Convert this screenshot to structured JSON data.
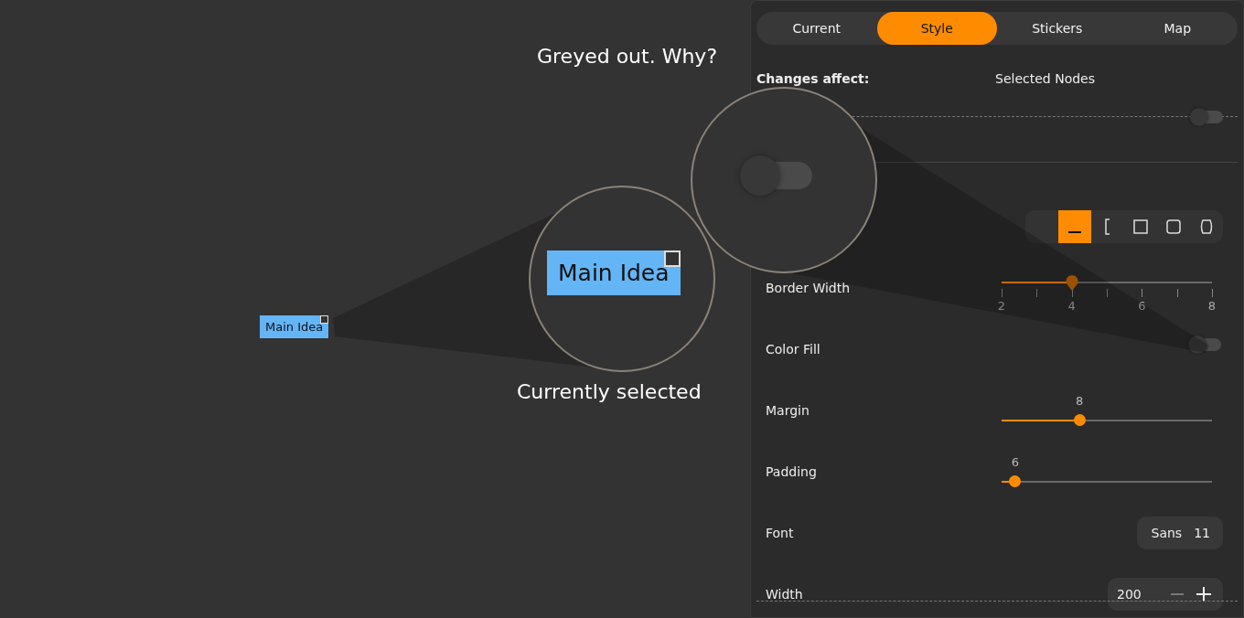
{
  "canvas": {
    "node": {
      "label": "Main Idea",
      "selected": true
    }
  },
  "annotations": [
    {
      "kind": "toggle",
      "on": false,
      "caption": "Greyed out. Why?"
    },
    {
      "kind": "node",
      "label": "Main Idea",
      "selected": true,
      "caption": "Currently selected"
    }
  ],
  "panel": {
    "tabs": [
      {
        "label": "Current",
        "selected": false
      },
      {
        "label": "Style",
        "selected": true
      },
      {
        "label": "Stickers",
        "selected": false
      },
      {
        "label": "Map",
        "selected": false
      }
    ],
    "rows": [
      {
        "kind": "text",
        "label": "Changes affect:",
        "value": "Selected Nodes"
      },
      {
        "kind": "toggle",
        "on": false,
        "disabled": true
      },
      {
        "kind": "shapes",
        "options": [
          {
            "kind": "underline",
            "selected": true
          },
          {
            "kind": "bracket",
            "selected": false
          },
          {
            "kind": "square",
            "selected": false
          },
          {
            "kind": "rounded",
            "selected": false
          },
          {
            "kind": "pill",
            "selected": false
          }
        ]
      },
      {
        "kind": "ticked-slider",
        "label": "Border Width",
        "level": 0.333,
        "tick_labels": [
          "2",
          "4",
          "6",
          "8"
        ]
      },
      {
        "kind": "toggle",
        "label": "Color Fill",
        "on": false,
        "disabled": true
      },
      {
        "kind": "slider",
        "label": "Margin",
        "value": "8",
        "level": 0.37
      },
      {
        "kind": "slider",
        "label": "Padding",
        "value": "6",
        "level": 0.065
      },
      {
        "kind": "font",
        "label": "Font",
        "family": "Sans",
        "size": "11"
      },
      {
        "kind": "spin",
        "label": "Width",
        "value": "200"
      }
    ]
  }
}
